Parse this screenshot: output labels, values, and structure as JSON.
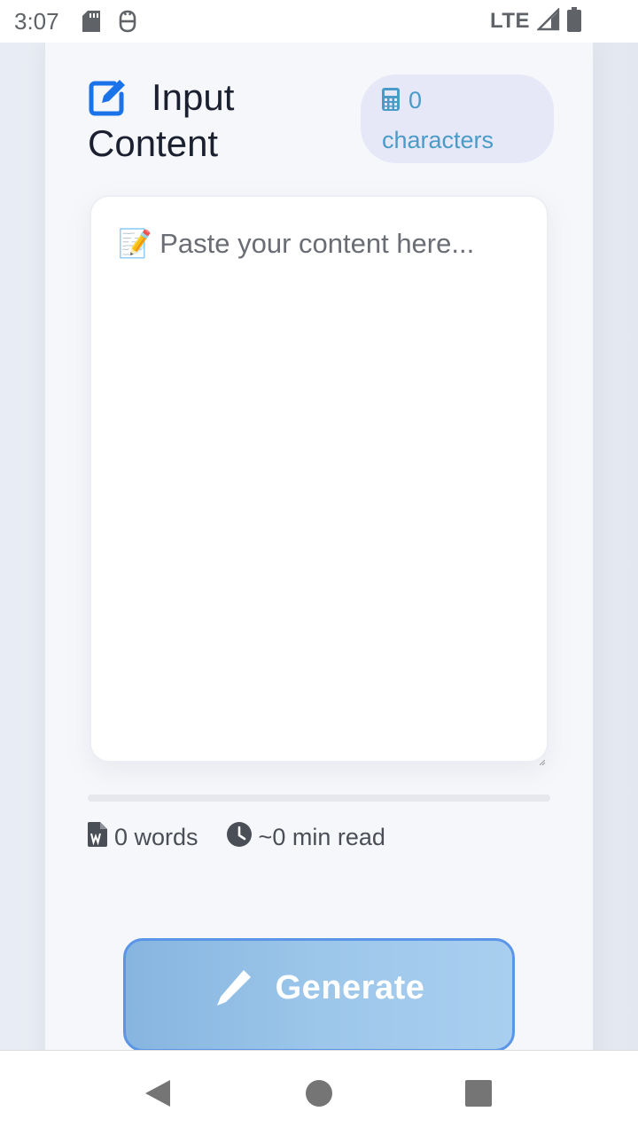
{
  "status_bar": {
    "time": "3:07",
    "network": "LTE",
    "icons": [
      "sd-card-icon",
      "notification-icon",
      "signal-icon",
      "battery-icon"
    ]
  },
  "editor": {
    "title": "Input Content",
    "title_icon": "edit-icon",
    "char_count": {
      "icon": "calculator-icon",
      "value": "0",
      "label": "characters"
    },
    "textarea": {
      "value": "",
      "placeholder": "📝 Paste your content here..."
    },
    "progress": 0,
    "stats": {
      "words": "0 words",
      "read_time": "~0 min read"
    },
    "generate_button": {
      "label": "Generate",
      "icon": "pen-icon"
    }
  },
  "nav_bar": {
    "buttons": [
      "back-icon",
      "home-icon",
      "recents-icon"
    ]
  },
  "colors": {
    "accent": "#1a73e8",
    "badge_text": "#4a9bc7",
    "badge_bg": "#e6e8f8",
    "button_gradient_start": "#86b5e0",
    "button_gradient_end": "#a9cfef"
  }
}
